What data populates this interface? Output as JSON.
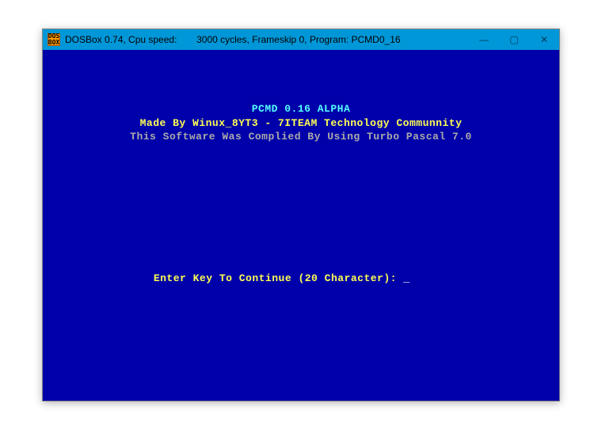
{
  "titlebar": {
    "icon_text": "DOS\nBOX",
    "segment1": "DOSBox 0.74, Cpu speed:",
    "segment2": "3000 cycles, Frameskip  0, Program: PCMD0_16",
    "minimize": "—",
    "maximize": "▢",
    "close": "✕"
  },
  "splash": {
    "line1": "PCMD 0.16 ALPHA",
    "line2": "Made By Winux_8YT3 - 7ITEAM Technology Communnity",
    "line3": "This Software Was Complied By Using Turbo Pascal 7.0"
  },
  "prompt": {
    "label": "Enter Key To Continue (20 Character): ",
    "cursor": "_"
  }
}
